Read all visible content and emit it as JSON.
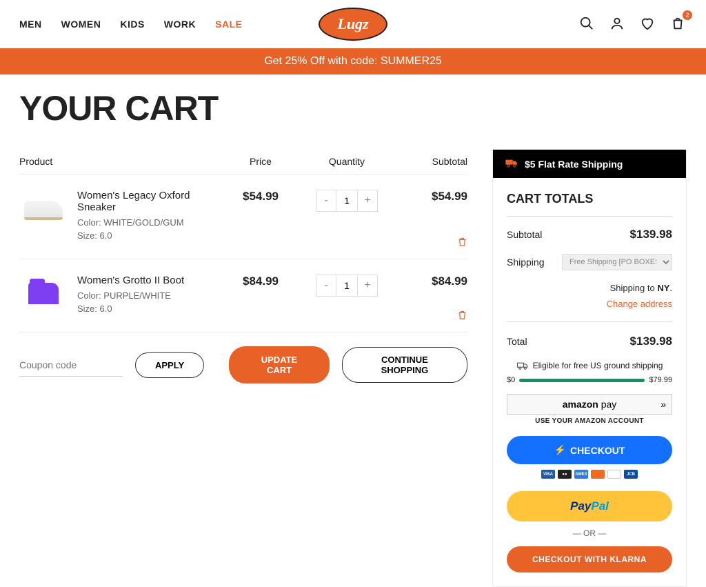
{
  "header": {
    "nav": [
      "MEN",
      "WOMEN",
      "KIDS",
      "WORK",
      "SALE"
    ],
    "logo": "Lugz",
    "cart_count": "2"
  },
  "promo": "Get 25% Off with code: SUMMER25",
  "page_title": "YOUR CART",
  "columns": {
    "product": "Product",
    "price": "Price",
    "quantity": "Quantity",
    "subtotal": "Subtotal"
  },
  "items": [
    {
      "name": "Women's Legacy Oxford Sneaker",
      "color_label": "Color: WHITE/GOLD/GUM",
      "size_label": "Size: 6.0",
      "price": "$54.99",
      "qty": "1",
      "subtotal": "$54.99"
    },
    {
      "name": "Women's Grotto II Boot",
      "color_label": "Color: PURPLE/WHITE",
      "size_label": "Size: 6.0",
      "price": "$84.99",
      "qty": "1",
      "subtotal": "$84.99"
    }
  ],
  "coupon_placeholder": "Coupon code",
  "buttons": {
    "apply": "APPLY",
    "update": "UPDATE CART",
    "continue": "CONTINUE SHOPPING",
    "checkout": "CHECKOUT",
    "klarna": "CHECKOUT WITH KLARNA"
  },
  "sidebar": {
    "ship_banner": "$5 Flat Rate Shipping",
    "title": "CART TOTALS",
    "subtotal_label": "Subtotal",
    "subtotal_value": "$139.98",
    "shipping_label": "Shipping",
    "shipping_option": "Free Shipping [PO BOXES NOT ALL",
    "ship_to_prefix": "Shipping to ",
    "ship_to_state": "NY",
    "change_address": "Change address",
    "total_label": "Total",
    "total_value": "$139.98",
    "eligible": "Eligible for free US ground shipping",
    "progress_min": "$0",
    "progress_max": "$79.99",
    "amazon_label": "amazon pay",
    "amazon_sub": "USE YOUR AMAZON ACCOUNT",
    "or": "— OR —"
  }
}
